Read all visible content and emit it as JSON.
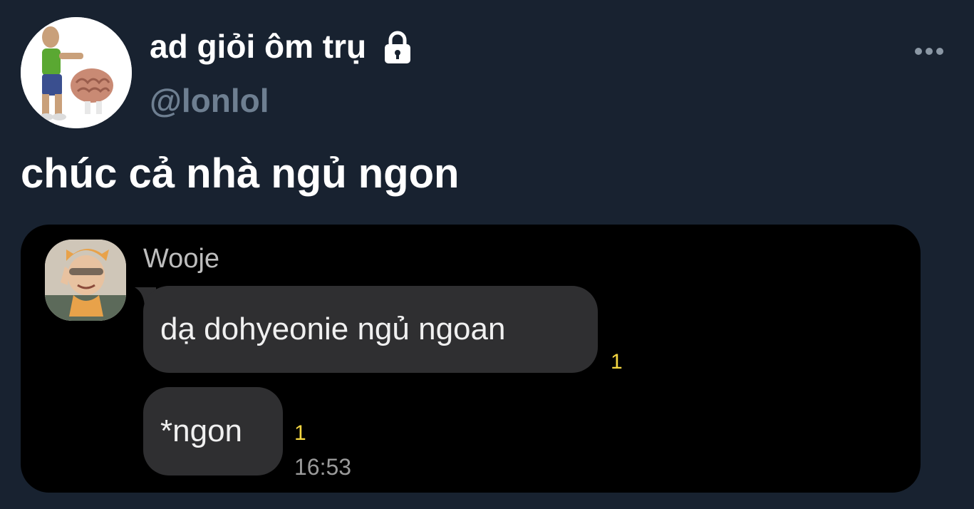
{
  "author": {
    "display_name": "ad giỏi ôm trụ",
    "handle": "@lonlol",
    "protected_icon": "lock-icon"
  },
  "tweet": {
    "text": "chúc cả nhà ngủ ngon"
  },
  "media": {
    "chat": {
      "sender": "Wooje",
      "messages": [
        {
          "text": "dạ dohyeonie ngủ ngoan",
          "unread": "1"
        },
        {
          "text": "*ngon",
          "unread": "1",
          "time": "16:53"
        }
      ]
    }
  },
  "icons": {
    "more": "more-horizontal-icon",
    "lock": "lock-icon"
  },
  "colors": {
    "background": "#182230",
    "handle": "#6e7f91",
    "bubble": "#2f2f31",
    "unread": "#f5d742"
  }
}
